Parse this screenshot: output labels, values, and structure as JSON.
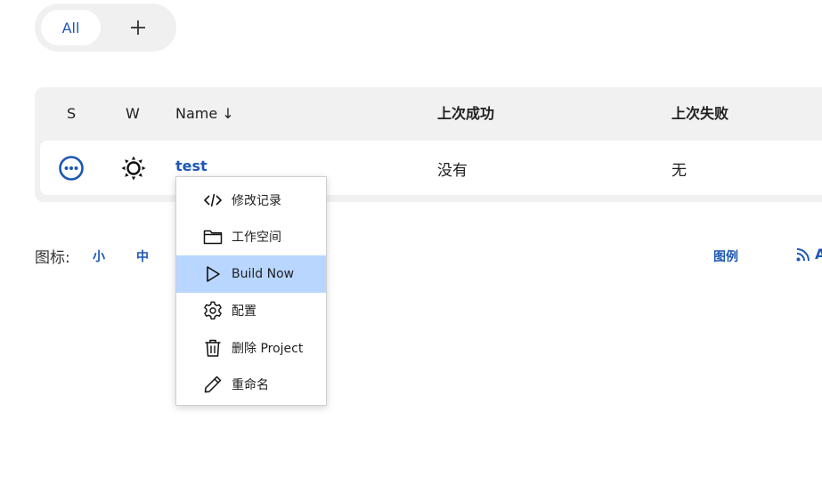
{
  "view_tabs": {
    "all_label": "All",
    "add_label": "+"
  },
  "table": {
    "headers": {
      "status": "S",
      "weather": "W",
      "name": "Name ↓",
      "last_success": "上次成功",
      "last_failure": "上次失败"
    },
    "rows": [
      {
        "status_icon": "in-progress-icon",
        "weather_icon": "sunny-icon",
        "name": "test",
        "last_success": "没有",
        "last_failure": "无"
      }
    ]
  },
  "icon_size": {
    "label": "图标:",
    "small": "小",
    "medium": "中"
  },
  "legend_label": "图例",
  "rss_label": "A",
  "context_menu": {
    "items": [
      {
        "label": "修改记录",
        "icon": "code-icon"
      },
      {
        "label": "工作空间",
        "icon": "folder-icon"
      },
      {
        "label": "Build Now",
        "icon": "play-icon",
        "active": true
      },
      {
        "label": "配置",
        "icon": "gear-icon"
      },
      {
        "label": "删除 Project",
        "icon": "trash-icon"
      },
      {
        "label": "重命名",
        "icon": "pencil-icon"
      }
    ]
  },
  "colors": {
    "link": "#1d57b5",
    "active_menu_bg": "#b8d6ff",
    "table_bg": "#f1f1f1"
  }
}
